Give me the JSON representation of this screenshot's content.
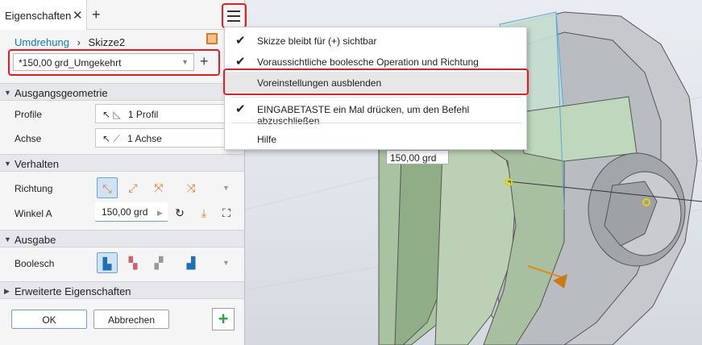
{
  "panel": {
    "tab_title": "Eigenschaften",
    "breadcrumb": {
      "feature": "Umdrehung",
      "sketch": "Skizze2"
    },
    "preset_value": "*150,00 grd_Umgekehrt",
    "sections": {
      "ausgangsgeometrie": {
        "title": "Ausgangsgeometrie",
        "profile_label": "Profile",
        "profile_value": "1 Profil",
        "axis_label": "Achse",
        "axis_value": "1 Achse"
      },
      "verhalten": {
        "title": "Verhalten",
        "direction_label": "Richtung",
        "angle_label": "Winkel A",
        "angle_value": "150,00 grd"
      },
      "ausgabe": {
        "title": "Ausgabe",
        "boolean_label": "Boolesch"
      },
      "erweitert": {
        "title": "Erweiterte Eigenschaften"
      }
    },
    "buttons": {
      "ok": "OK",
      "cancel": "Abbrechen"
    }
  },
  "context_menu": {
    "items": [
      {
        "label": "Skizze bleibt für (+) sichtbar",
        "checked": true
      },
      {
        "label": "Voraussichtliche boolesche Operation und Richtung",
        "checked": true
      },
      {
        "label": "Voreinstellungen ausblenden",
        "checked": false,
        "highlighted": true
      },
      {
        "label": "EINGABETASTE ein Mal drücken, um den Befehl abzuschließen",
        "checked": true
      },
      {
        "label": "Hilfe",
        "checked": false
      }
    ]
  },
  "viewport": {
    "dimension_label": "150,00 grd"
  },
  "colors": {
    "highlight_red": "#e41e26",
    "link_blue": "#0f7bbd",
    "accent_orange": "#e07a22",
    "confirm_green": "#2aa43a"
  }
}
